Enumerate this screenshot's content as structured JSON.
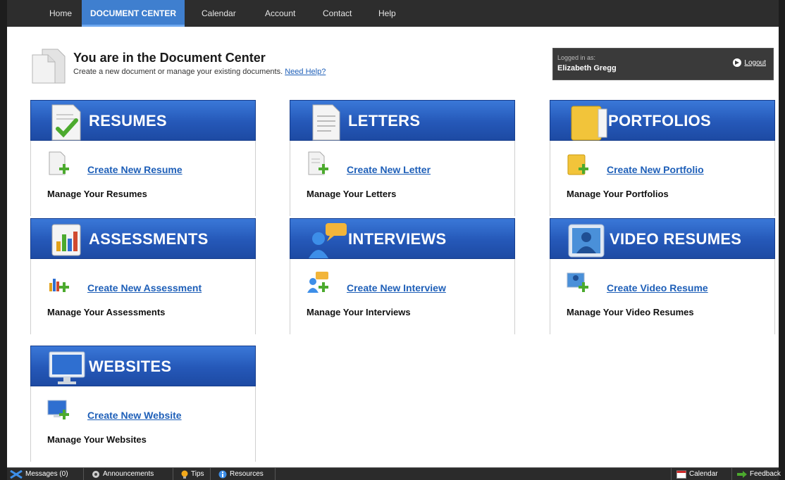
{
  "nav": {
    "items": [
      {
        "label": "Home"
      },
      {
        "label": "DOCUMENT CENTER"
      },
      {
        "label": "Calendar"
      },
      {
        "label": "Account"
      },
      {
        "label": "Contact"
      },
      {
        "label": "Help"
      }
    ]
  },
  "header": {
    "title": "You are in the Document Center",
    "subtitle": "Create a new document or manage your existing documents.",
    "help_link": "Need Help?"
  },
  "login": {
    "label": "Logged in as:",
    "name": "Elizabeth Gregg",
    "logout": "Logout"
  },
  "cards": [
    {
      "title": "RESUMES",
      "create": "Create New Resume",
      "manage": "Manage Your Resumes"
    },
    {
      "title": "LETTERS",
      "create": "Create New Letter",
      "manage": "Manage Your Letters"
    },
    {
      "title": "PORTFOLIOS",
      "create": "Create New Portfolio",
      "manage": "Manage Your Portfolios"
    },
    {
      "title": "ASSESSMENTS",
      "create": "Create New Assessment",
      "manage": "Manage Your Assessments"
    },
    {
      "title": "INTERVIEWS",
      "create": "Create New Interview",
      "manage": "Manage Your Interviews"
    },
    {
      "title": "VIDEO RESUMES",
      "create": "Create Video Resume",
      "manage": "Manage Your Video Resumes"
    },
    {
      "title": "WEBSITES",
      "create": "Create New Website",
      "manage": "Manage Your Websites"
    }
  ],
  "bottombar": {
    "messages": "Messages (0)",
    "announcements": "Announcements",
    "tips": "Tips",
    "resources": "Resources",
    "calendar": "Calendar",
    "feedback": "Feedback"
  },
  "colors": {
    "header_blue": "#2558b8",
    "link_blue": "#1e5fb8",
    "nav_active": "#3f7fcf",
    "plus_green": "#4caa2e"
  }
}
